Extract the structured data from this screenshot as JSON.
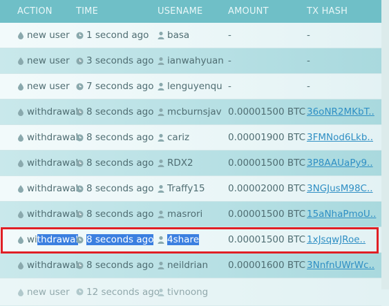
{
  "headers": {
    "action": "ACTION",
    "time": "TIME",
    "username": "USENAME",
    "amount": "AMOUNT",
    "tx_hash": "TX HASH"
  },
  "rows": [
    {
      "action": "new user",
      "time": "1 second ago",
      "user": "basa",
      "amount": "-",
      "hash": "-"
    },
    {
      "action": "new user",
      "time": "3 seconds ago",
      "user": "ianwahyuan",
      "amount": "-",
      "hash": "-"
    },
    {
      "action": "new user",
      "time": "7 seconds ago",
      "user": "lenguyenqu",
      "amount": "-",
      "hash": "-"
    },
    {
      "action": "withdrawal",
      "time": "8 seconds ago",
      "user": "mcburnsjav",
      "amount": "0.00001500 BTC",
      "hash": "36oNR2MKbT.."
    },
    {
      "action": "withdrawal",
      "time": "8 seconds ago",
      "user": "cariz",
      "amount": "0.00001900 BTC",
      "hash": "3FMNod6Lkb.."
    },
    {
      "action": "withdrawal",
      "time": "8 seconds ago",
      "user": "RDX2",
      "amount": "0.00001500 BTC",
      "hash": "3P8AAUaPy9.."
    },
    {
      "action": "withdrawal",
      "time": "8 seconds ago",
      "user": "Traffy15",
      "amount": "0.00002000 BTC",
      "hash": "3NGJusM98C.."
    },
    {
      "action": "withdrawal",
      "time": "8 seconds ago",
      "user": "masrori",
      "amount": "0.00001500 BTC",
      "hash": "15aNhaPmoU.."
    },
    {
      "action_prefix": "wi",
      "action": "thdrawal",
      "time": "8 seconds ago",
      "user": "4share",
      "amount": "0.00001500 BTC",
      "hash": "1xJsqwJRoe.."
    },
    {
      "action": "withdrawal",
      "time": "8 seconds ago",
      "user": "neildrian",
      "amount": "0.00001600 BTC",
      "hash": "3NnfnUWrWc.."
    },
    {
      "action": "new user",
      "time": "12 seconds ago",
      "user": "tivnoong",
      "amount": "",
      "hash": ""
    }
  ],
  "icons": {
    "action": "drop-icon",
    "time": "clock-icon",
    "user": "user-icon"
  },
  "colors": {
    "header_bg": "#6fbfc7",
    "link": "#2f8fc4",
    "selection": "#3b7fe0",
    "highlight_border": "#e01f25"
  }
}
